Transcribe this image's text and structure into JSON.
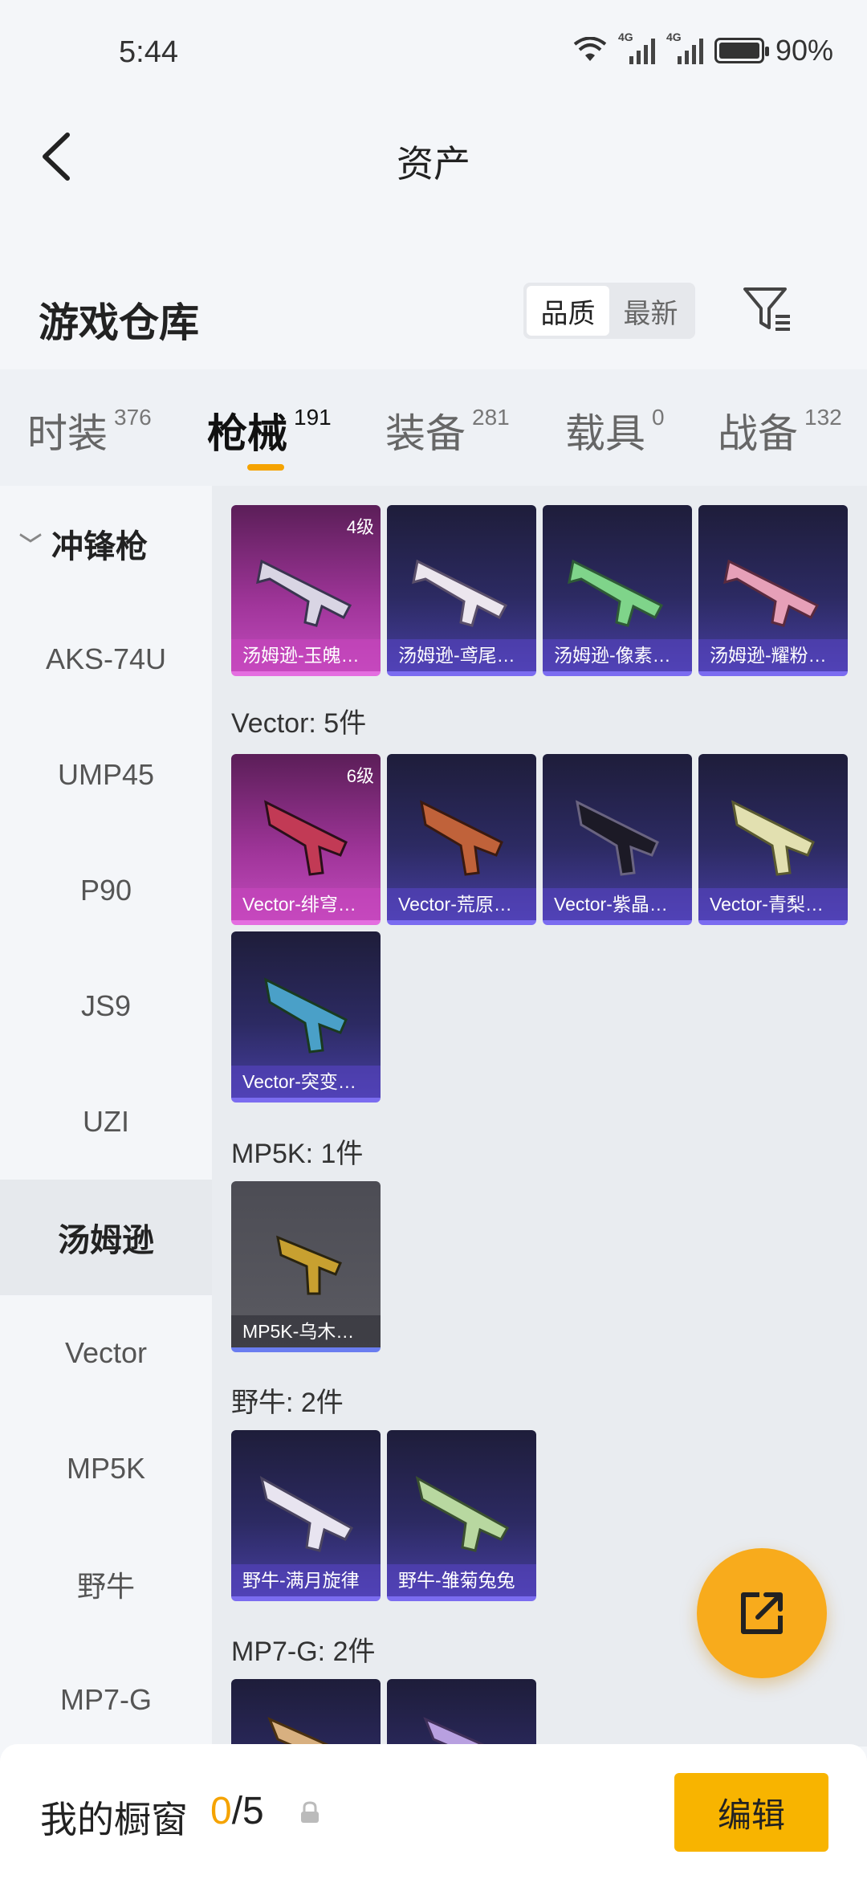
{
  "status_bar": {
    "time": "5:44",
    "battery": "90%",
    "net1": "4G",
    "net2": "4G"
  },
  "header": {
    "title": "资产"
  },
  "warehouse": {
    "title": "游戏仓库",
    "sort_options": [
      "品质",
      "最新"
    ],
    "selected_sort": "品质"
  },
  "tabs": [
    {
      "label": "时装",
      "count": "376"
    },
    {
      "label": "枪械",
      "count": "191"
    },
    {
      "label": "装备",
      "count": "281"
    },
    {
      "label": "载具",
      "count": "0"
    },
    {
      "label": "战备",
      "count": "132"
    }
  ],
  "sidebar": {
    "group": "冲锋枪",
    "items": [
      "AKS-74U",
      "UMP45",
      "P90",
      "JS9",
      "UZI",
      "汤姆逊",
      "Vector",
      "MP5K",
      "野牛",
      "MP7-G"
    ],
    "selected": "汤姆逊"
  },
  "groups": {
    "thompson": {
      "items": [
        {
          "name": "汤姆逊-玉魄…",
          "level": "4级"
        },
        {
          "name": "汤姆逊-鸢尾…"
        },
        {
          "name": "汤姆逊-像素…"
        },
        {
          "name": "汤姆逊-耀粉…"
        }
      ]
    },
    "vector": {
      "label": "Vector: 5件",
      "items": [
        {
          "name": "Vector-绯穹…",
          "level": "6级"
        },
        {
          "name": "Vector-荒原…"
        },
        {
          "name": "Vector-紫晶…"
        },
        {
          "name": "Vector-青梨…"
        },
        {
          "name": "Vector-突变…"
        }
      ]
    },
    "mp5k": {
      "label": "MP5K: 1件",
      "items": [
        {
          "name": "MP5K-乌木…"
        }
      ]
    },
    "bison": {
      "label": "野牛: 2件",
      "items": [
        {
          "name": "野牛-满月旋律"
        },
        {
          "name": "野牛-雏菊兔兔"
        }
      ]
    },
    "mp7g": {
      "label": "MP7-G: 2件"
    }
  },
  "bottom_bar": {
    "showcase_label": "我的橱窗",
    "count_current": "0",
    "count_total": "/5",
    "edit_label": "编辑"
  },
  "colors": {
    "accent": "#f5a300",
    "fab": "#f8ab1c",
    "edit": "#f8b400"
  }
}
